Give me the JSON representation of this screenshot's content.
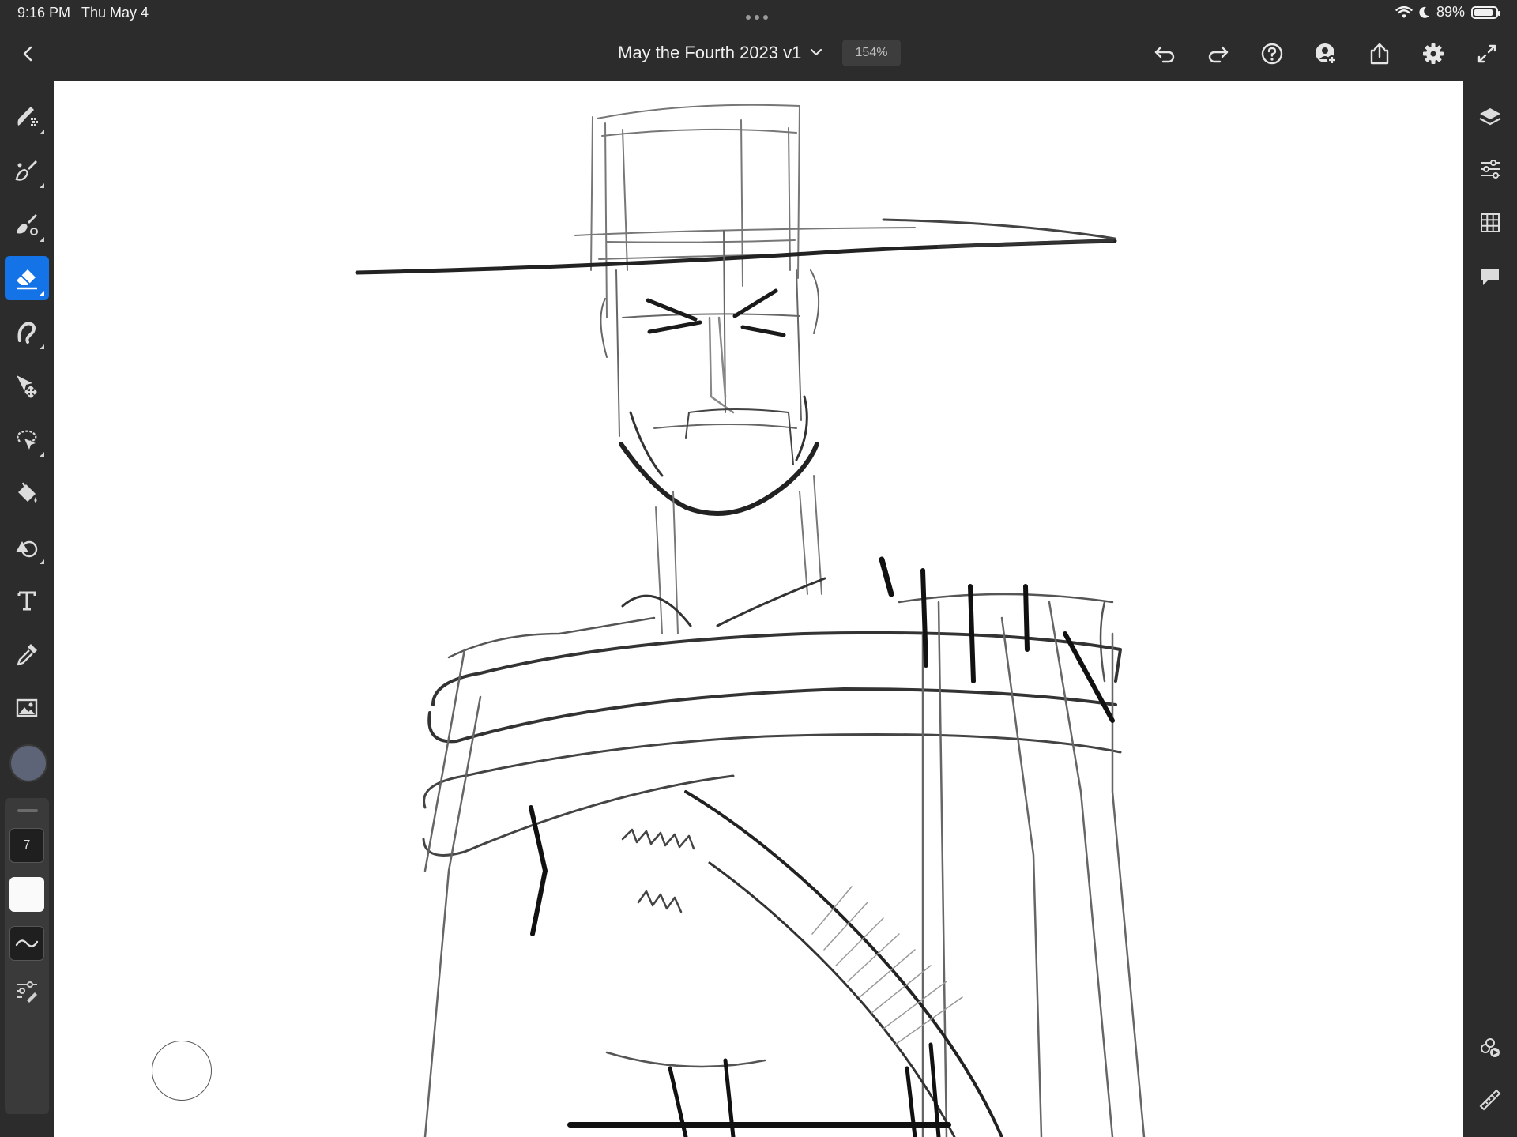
{
  "status_bar": {
    "time": "9:16 PM",
    "date": "Thu May 4",
    "battery_percent": "89%",
    "battery_level": 0.89
  },
  "top_bar": {
    "document_title": "May the Fourth 2023 v1",
    "zoom": "154%",
    "icons": [
      "back-icon",
      "chevron-down-icon",
      "undo-icon",
      "redo-icon",
      "help-icon",
      "invite-icon",
      "share-icon",
      "settings-icon",
      "fullscreen-icon"
    ]
  },
  "left_toolbar": {
    "tools": [
      "pixel-brush",
      "live-brush",
      "vector-brush",
      "eraser",
      "smudge",
      "transform",
      "selection",
      "fill",
      "shapes",
      "text",
      "eyedropper",
      "image"
    ],
    "active_tool": "eraser",
    "active_color": "#5e6478",
    "brush_size": "7",
    "accent_color": "#1473e6"
  },
  "right_toolbar": {
    "icons": [
      "layers-icon",
      "layer-properties-icon",
      "grid-icon",
      "comments-icon",
      "timelapse-icon",
      "ruler-icon"
    ]
  }
}
